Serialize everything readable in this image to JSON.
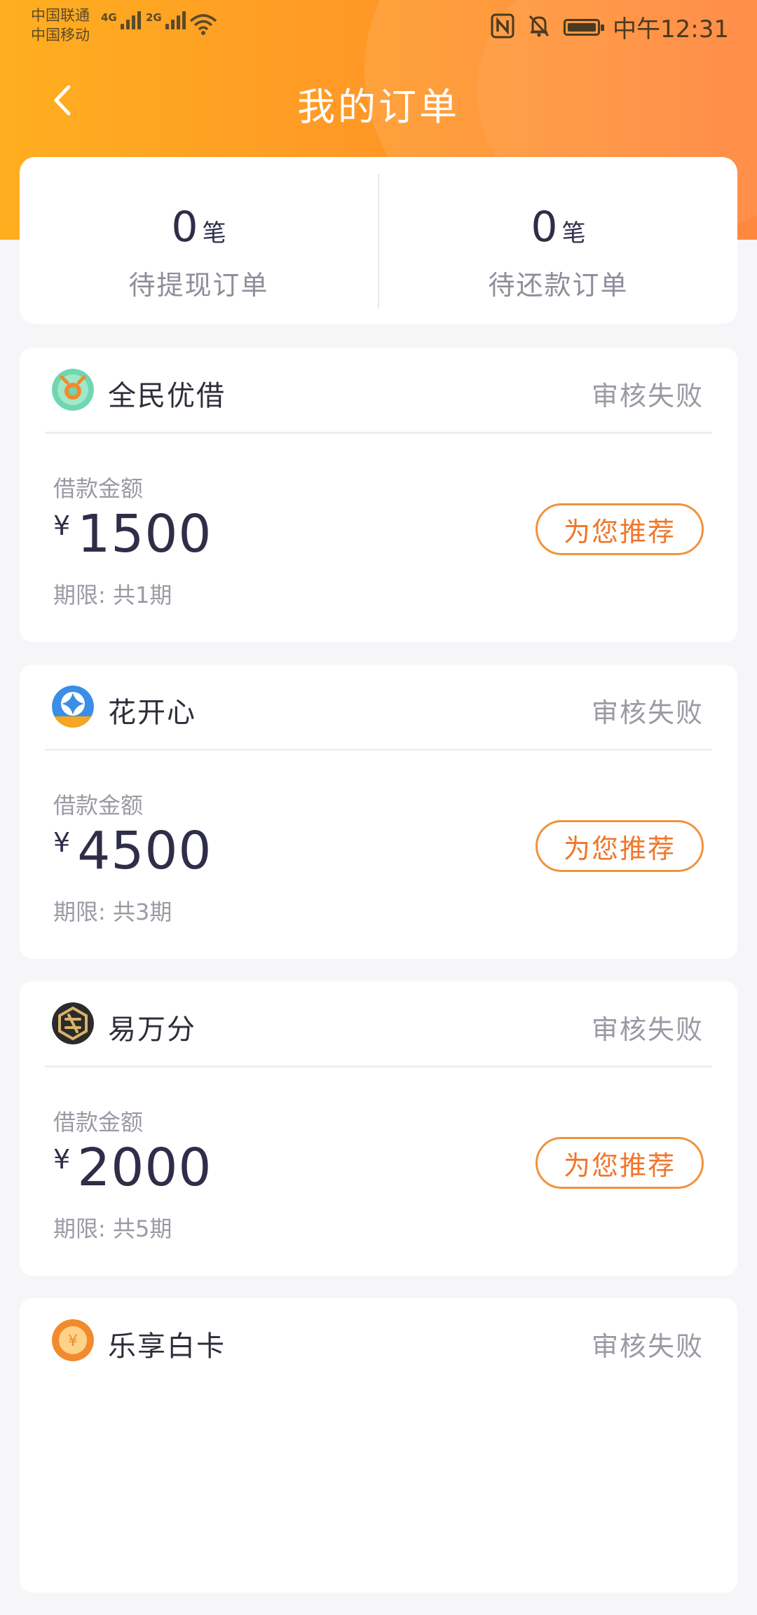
{
  "status_bar": {
    "carrier_1": "中国联通",
    "carrier_2": "中国移动",
    "network_1": "4G",
    "network_2": "2G",
    "time": "中午12:31",
    "icons": [
      "nfc-icon",
      "bell-muted-icon",
      "battery-icon",
      "wifi-icon",
      "signal-icon"
    ]
  },
  "header": {
    "title": "我的订单",
    "back_icon": "chevron-left-icon"
  },
  "summary": {
    "pending_withdraw": {
      "count": "0",
      "unit": "笔",
      "label": "待提现订单"
    },
    "pending_repay": {
      "count": "0",
      "unit": "笔",
      "label": "待还款订单"
    }
  },
  "orders": [
    {
      "name": "全民优借",
      "status": "审核失败",
      "amount_label": "借款金额",
      "currency": "¥",
      "amount": "1500",
      "term": "期限: 共1期",
      "button": "为您推荐",
      "logo_color": "#5fd1a8"
    },
    {
      "name": "花开心",
      "status": "审核失败",
      "amount_label": "借款金额",
      "currency": "¥",
      "amount": "4500",
      "term": "期限: 共3期",
      "button": "为您推荐",
      "logo_color": "#3a8ee6"
    },
    {
      "name": "易万分",
      "status": "审核失败",
      "amount_label": "借款金额",
      "currency": "¥",
      "amount": "2000",
      "term": "期限: 共5期",
      "button": "为您推荐",
      "logo_color": "#2b2b2b"
    },
    {
      "name": "乐享白卡",
      "status": "审核失败",
      "logo_color": "#f28a2e"
    }
  ],
  "colors": {
    "accent": "#ff9a26",
    "button_text": "#f0762a",
    "text_dark": "#2e2e48",
    "text_muted": "#9a9aa4"
  }
}
